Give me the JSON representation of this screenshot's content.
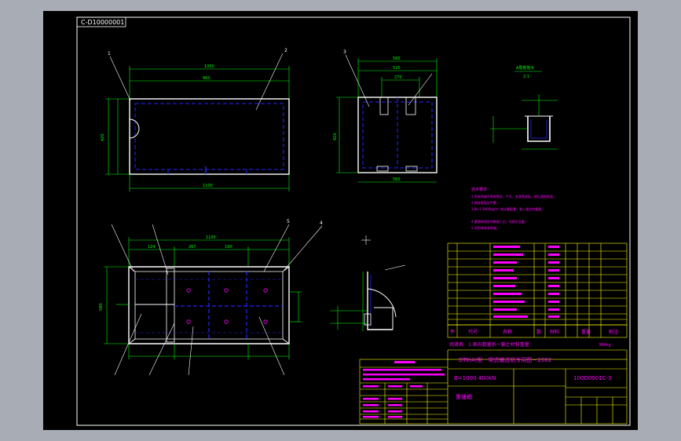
{
  "drawing": {
    "code_tag": "C-D10000001",
    "colors": {
      "frame_bg": "#a7acb5",
      "paper": "#000000",
      "border": "#ffffff",
      "outline": "#ffffff",
      "hidden": "#2424ff",
      "dim": "#00ff00",
      "note": "#ff00ff",
      "table": "#ffff00",
      "label": "#ffffff"
    },
    "title_block": {
      "standard_line": "DTⅡ(A)型　带式输送机专用图－2002",
      "header_cells": [
        "件",
        "代号",
        "名称",
        "数",
        "材料",
        "重量",
        "附注"
      ],
      "note_row": "润滑表　1.表内数量系一套之材料重量",
      "weight_tag": "384kg",
      "spec": "B=1000 400kN",
      "drawing_no": "100D0001C-3",
      "name": "重锤箱"
    },
    "notes_title": "技术要求",
    "notes_lines": [
      "1.所有焊缝不得有裂纹、气孔、夹渣等缺陷，焊后清除焊渣。",
      "2.焊接表面应平整。",
      "3.N=1 3600kg/m³ 按计算配重，装入规定的重量。",
      "4.重锤按规定块数装入后，须保证总重。",
      "5.涂防锈底漆两遍。"
    ],
    "detail_label": "A局部放大",
    "detail_scale": "2:1",
    "labels": {
      "n1": "1",
      "n2": "2",
      "n3": "3",
      "n4": "4",
      "n5": "5"
    }
  }
}
